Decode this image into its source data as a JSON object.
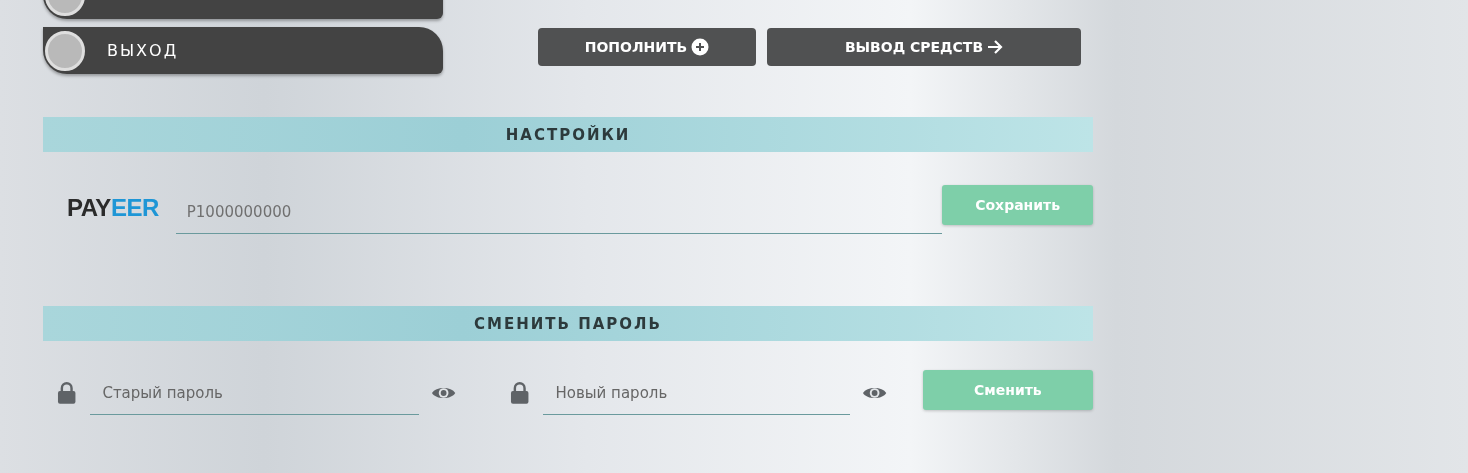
{
  "menu": [
    {
      "selected": false
    },
    {
      "label": "ВЫХОД",
      "selected": false
    }
  ],
  "actions": [
    {
      "label": "ПОПОЛНИТЬ",
      "kind": "plus"
    },
    {
      "label": "ВЫВОД СРЕДСТВ",
      "kind": "arrow"
    }
  ],
  "settings": {
    "title": "НАСТРОЙКИ",
    "logo": {
      "dark": "PAY",
      "accent": "EER"
    },
    "wallet": {
      "placeholder": "P1000000000"
    },
    "button": "Сохранить"
  },
  "password": {
    "title": "СМЕНИТЬ ПАРОЛЬ",
    "fields": [
      {
        "placeholder": "Старый пароль"
      },
      {
        "placeholder": "Новый пароль"
      }
    ],
    "button": "Сменить"
  }
}
